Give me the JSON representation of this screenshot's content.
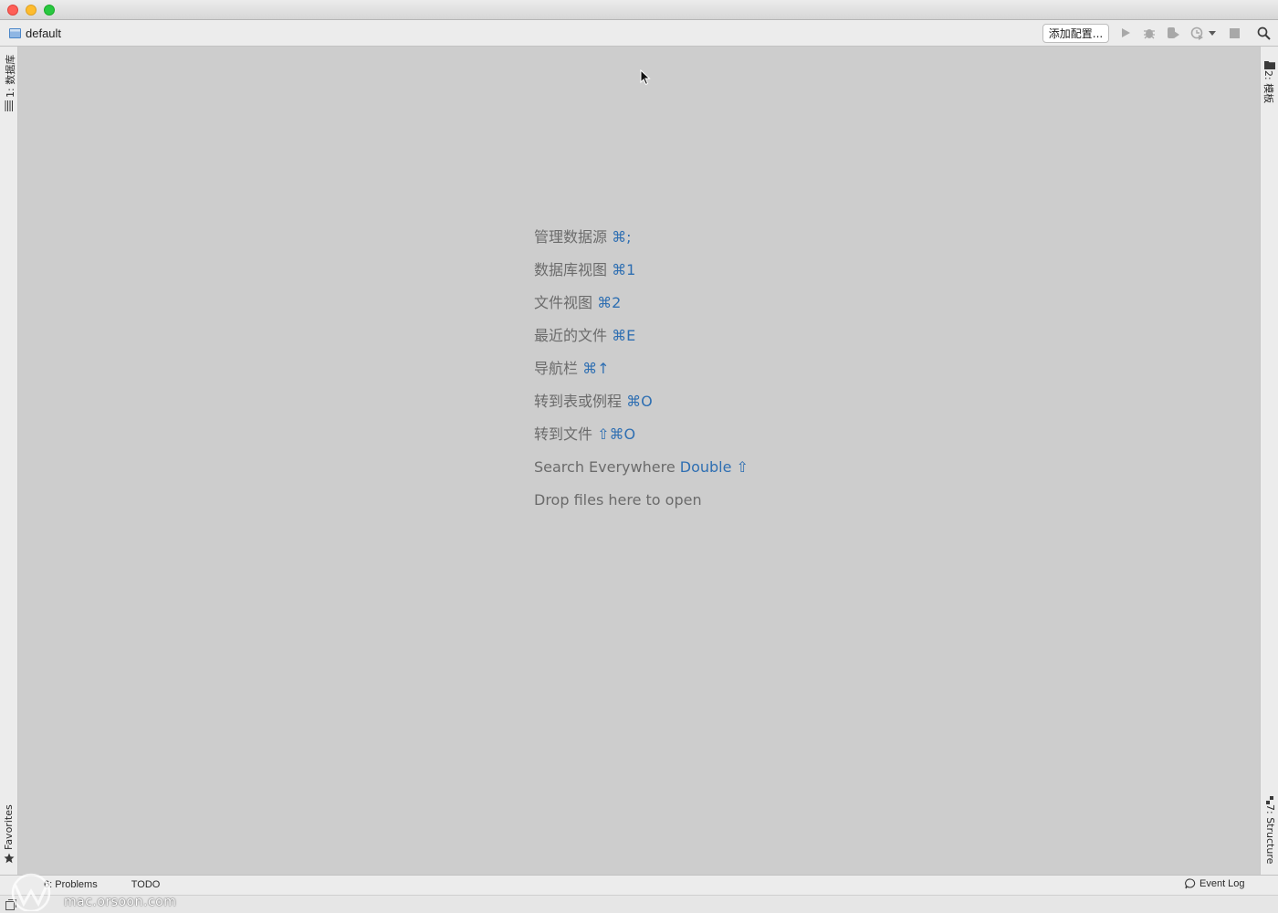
{
  "window": {
    "project_name": "default"
  },
  "toolbar": {
    "add_config_label": "添加配置...",
    "icons": [
      "run-icon",
      "debug-icon",
      "coverage-icon",
      "profile-icon",
      "dropdown-icon",
      "stop-icon",
      "search-icon"
    ]
  },
  "left_strip": {
    "top_tab": "1: 数据库",
    "bottom_tab": "Favorites"
  },
  "right_strip": {
    "top_tab": "2: 模板",
    "bottom_tab": "7: Structure"
  },
  "hints": [
    {
      "label": "管理数据源 ",
      "shortcut": "⌘;"
    },
    {
      "label": "数据库视图 ",
      "shortcut": "⌘1"
    },
    {
      "label": "文件视图 ",
      "shortcut": "⌘2"
    },
    {
      "label": "最近的文件 ",
      "shortcut": "⌘E"
    },
    {
      "label": "导航栏 ",
      "shortcut": "⌘↑"
    },
    {
      "label": "转到表或例程 ",
      "shortcut": "⌘O"
    },
    {
      "label": "转到文件 ",
      "shortcut": "⇧⌘O"
    },
    {
      "label": "Search Everywhere ",
      "shortcut": "Double ⇧"
    },
    {
      "label": "Drop files here to open",
      "shortcut": ""
    }
  ],
  "statusbar": {
    "problems_label": "6: Problems",
    "todo_label": "TODO",
    "event_log_label": "Event Log"
  },
  "watermark": {
    "text": "mac.orsoon.com"
  }
}
